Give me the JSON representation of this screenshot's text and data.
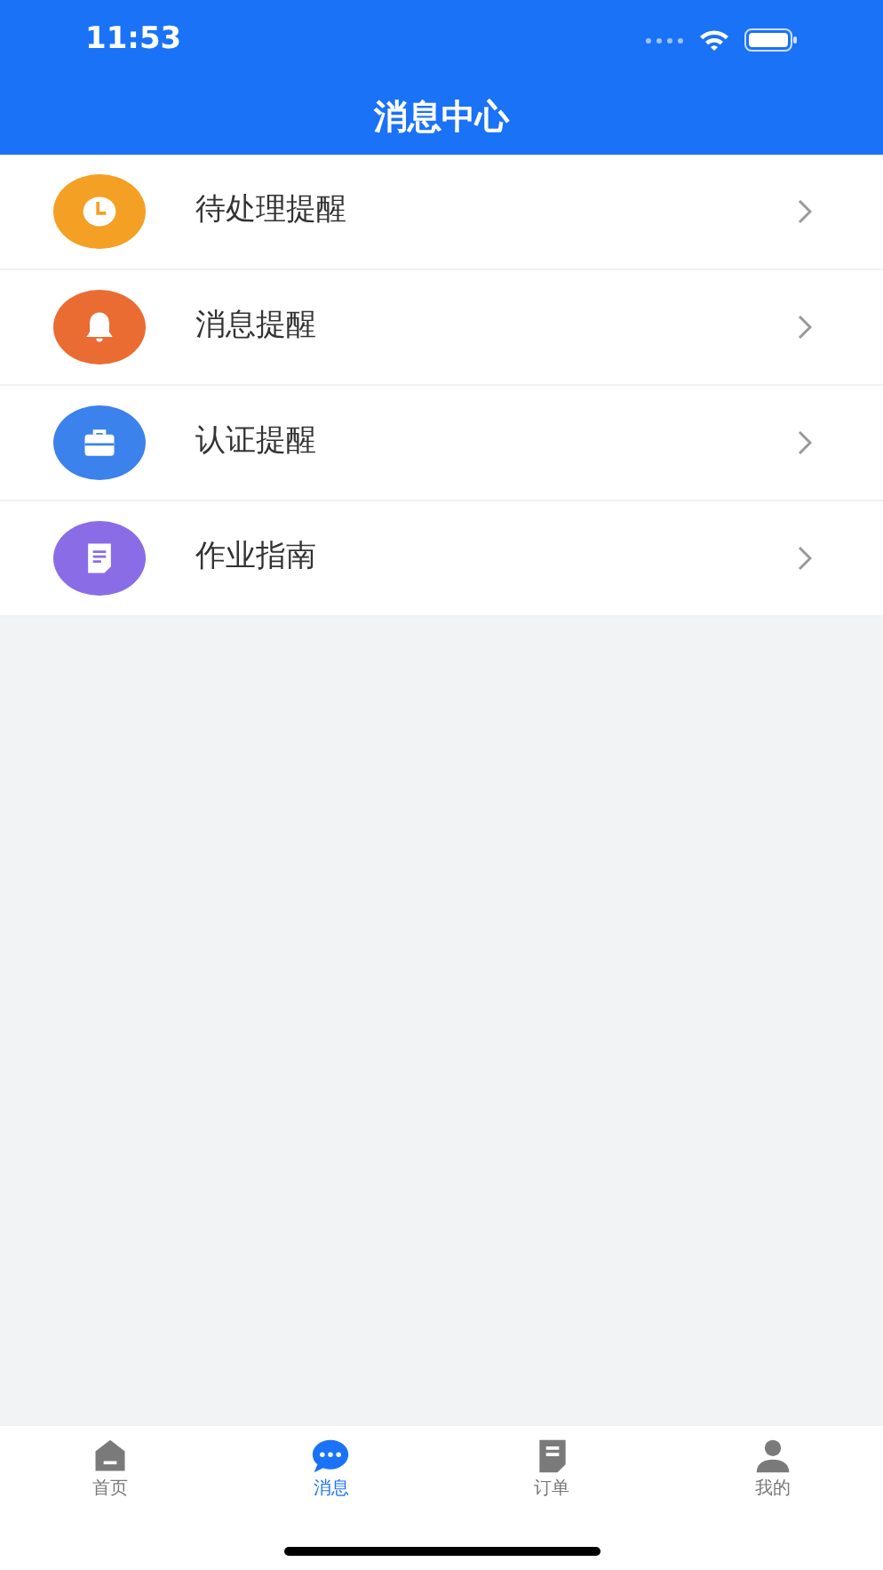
{
  "status_bar": {
    "time": "11:53"
  },
  "header": {
    "title": "消息中心"
  },
  "items": [
    {
      "label": "待处理提醒",
      "kind": "clock",
      "color": "#f4a024"
    },
    {
      "label": "消息提醒",
      "kind": "bell",
      "color": "#ea6c33"
    },
    {
      "label": "认证提醒",
      "kind": "briefcase",
      "color": "#3b82ec"
    },
    {
      "label": "作业指南",
      "kind": "document",
      "color": "#8a6de6"
    }
  ],
  "tab_bar": [
    {
      "label": "首页",
      "kind": "home",
      "selected": false
    },
    {
      "label": "消息",
      "kind": "chat",
      "selected": true
    },
    {
      "label": "订单",
      "kind": "order",
      "selected": false
    },
    {
      "label": "我的",
      "kind": "user",
      "selected": false
    }
  ]
}
